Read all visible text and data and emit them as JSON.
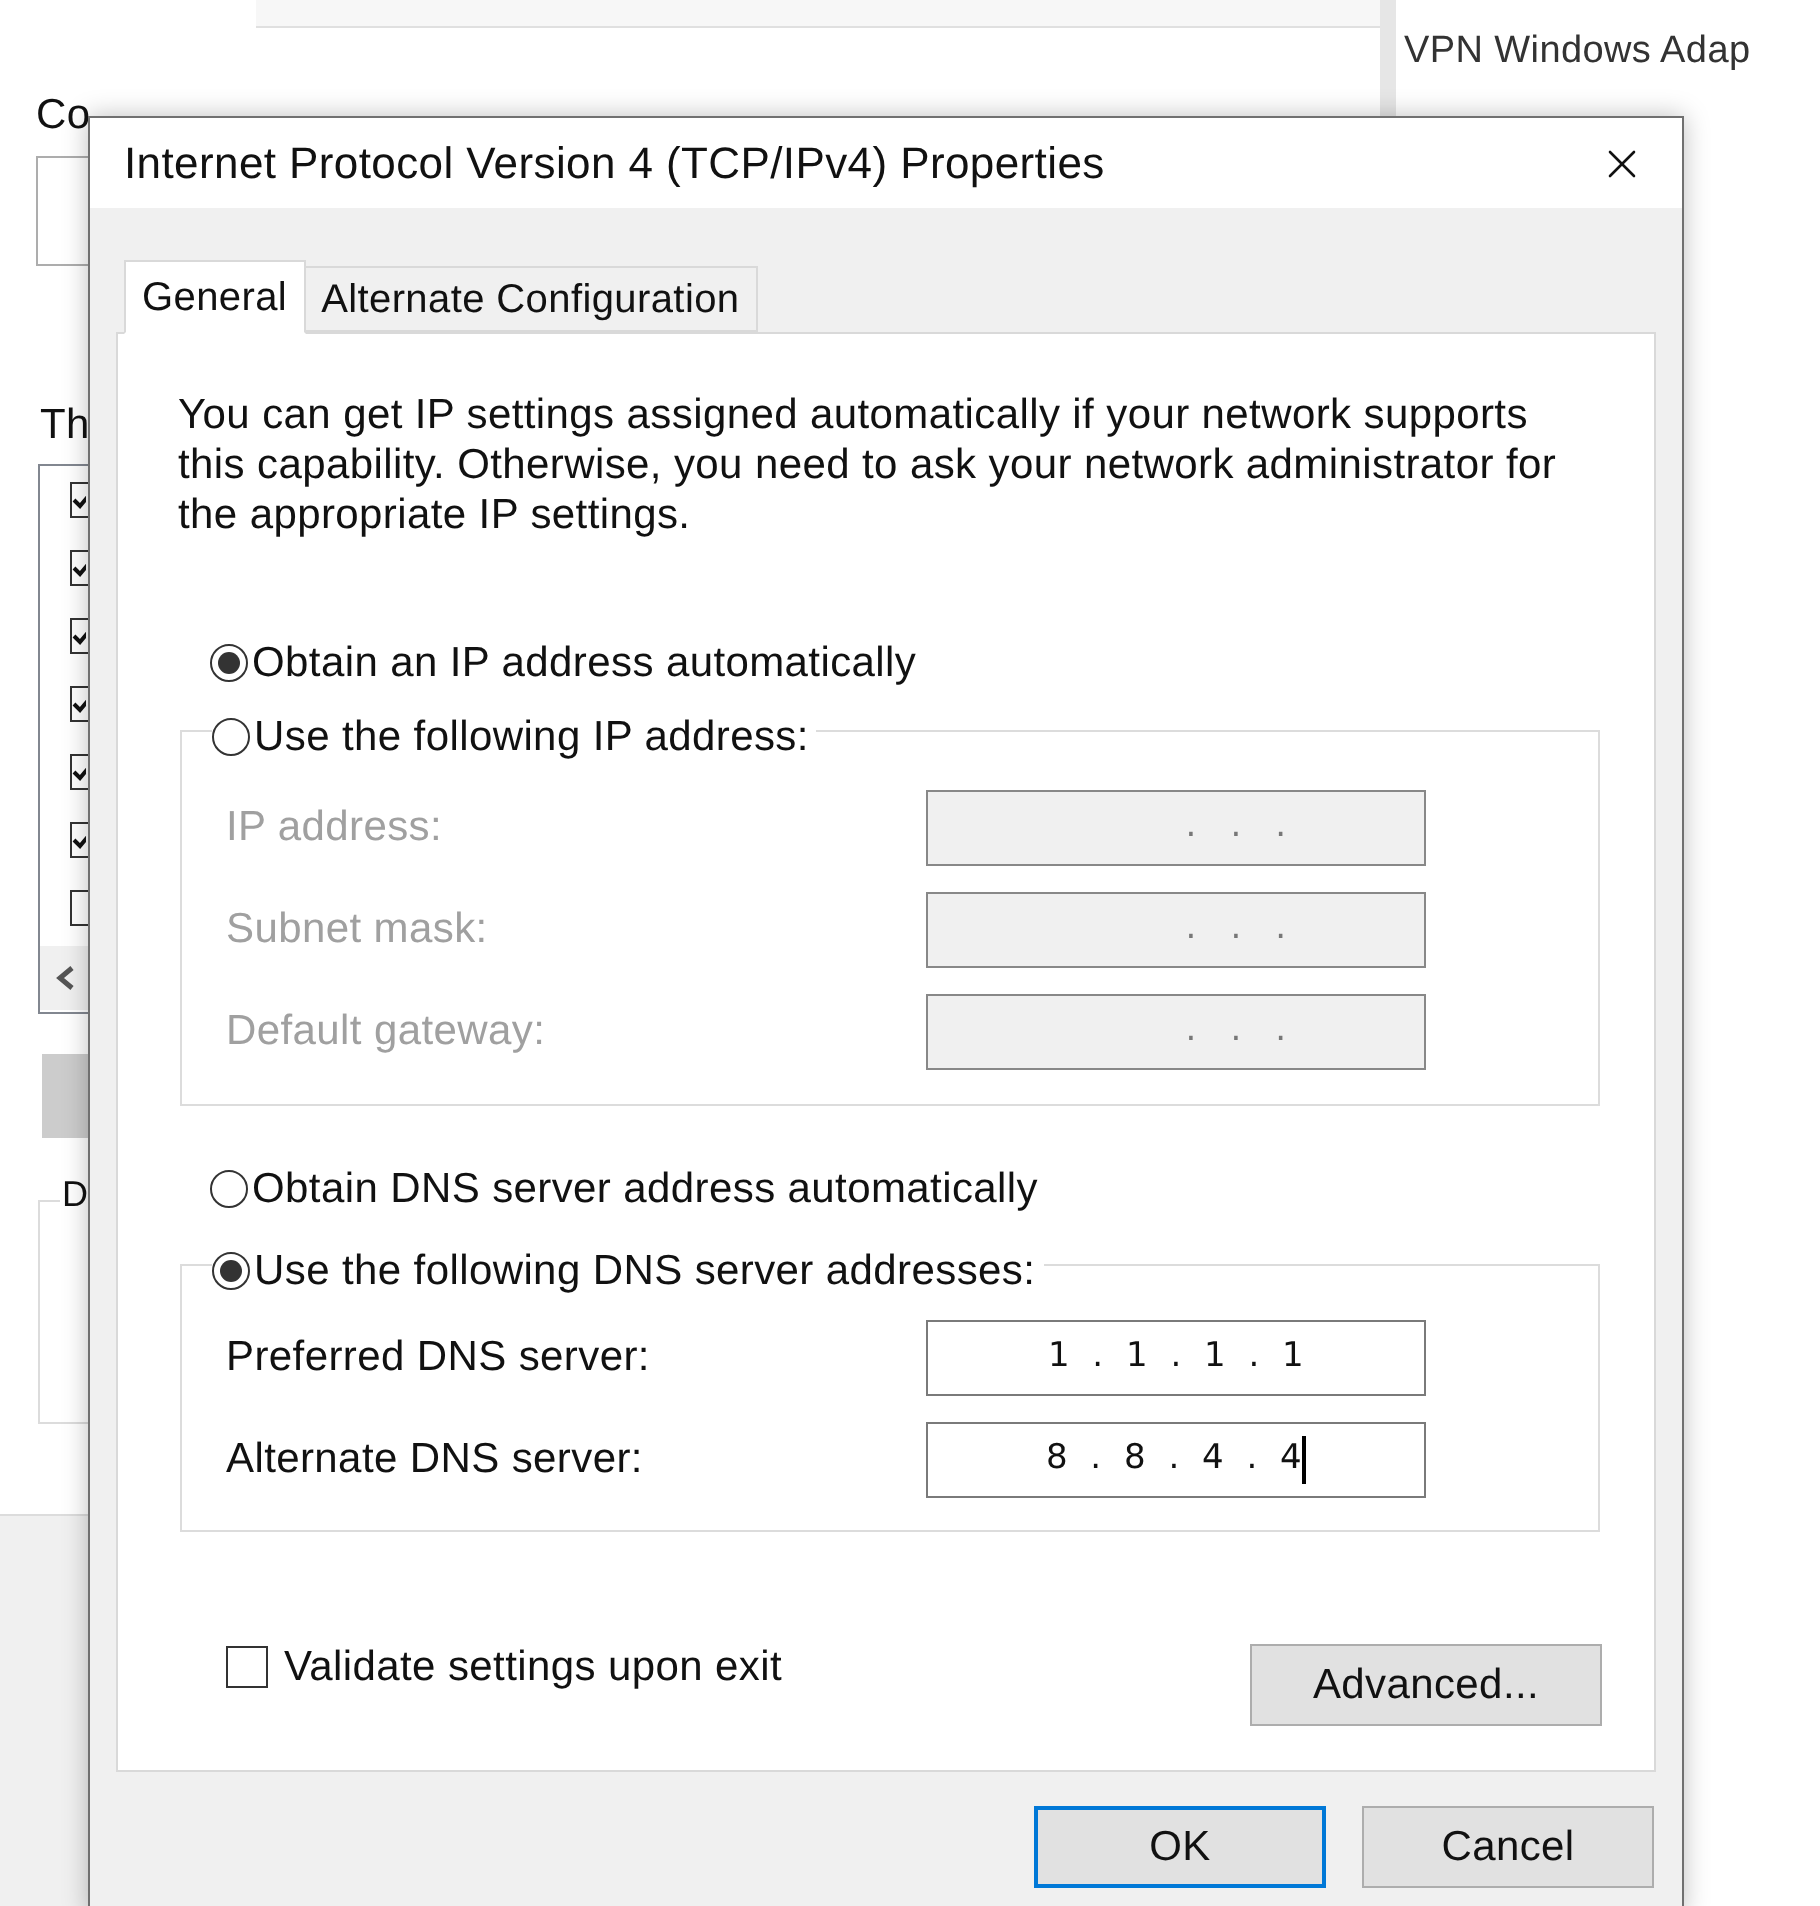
{
  "background_window": {
    "connect_label": "Co",
    "adapter_name": "VPN Windows Adap",
    "list_heading": "Th",
    "components": [
      {
        "checked": true
      },
      {
        "checked": true
      },
      {
        "checked": true
      },
      {
        "checked": true
      },
      {
        "checked": true
      },
      {
        "checked": true
      },
      {
        "checked": false
      }
    ],
    "group_label": "D"
  },
  "dialog": {
    "title": "Internet Protocol Version 4 (TCP/IPv4) Properties",
    "tabs": [
      {
        "label": "General",
        "selected": true
      },
      {
        "label": "Alternate Configuration",
        "selected": false
      }
    ],
    "description": "You can get IP settings assigned automatically if your network supports this capability. Otherwise, you need to ask your network administrator for the appropriate IP settings.",
    "ip_options": [
      {
        "label": "Obtain an IP address automatically",
        "selected": true
      },
      {
        "label": "Use the following IP address:",
        "selected": false
      }
    ],
    "ip_fields": [
      {
        "label": "IP address:",
        "value": ".   .   .",
        "disabled": true,
        "focused": false
      },
      {
        "label": "Subnet mask:",
        "value": ".   .   .",
        "disabled": true,
        "focused": false
      },
      {
        "label": "Default gateway:",
        "value": ".   .   .",
        "disabled": true,
        "focused": false
      }
    ],
    "dns_options": [
      {
        "label": "Obtain DNS server address automatically",
        "selected": false
      },
      {
        "label": "Use the following DNS server addresses:",
        "selected": true
      }
    ],
    "dns_fields": [
      {
        "label": "Preferred DNS server:",
        "value": "1  .  1  .  1  .  1",
        "disabled": false,
        "focused": false
      },
      {
        "label": "Alternate DNS server:",
        "value": "8  .  8  .  4  .  4",
        "disabled": false,
        "focused": true
      }
    ],
    "validate": {
      "label": "Validate settings upon exit",
      "checked": false
    },
    "advanced_button": "Advanced...",
    "buttons": [
      {
        "label": "OK",
        "default": true
      },
      {
        "label": "Cancel",
        "default": false
      }
    ]
  }
}
